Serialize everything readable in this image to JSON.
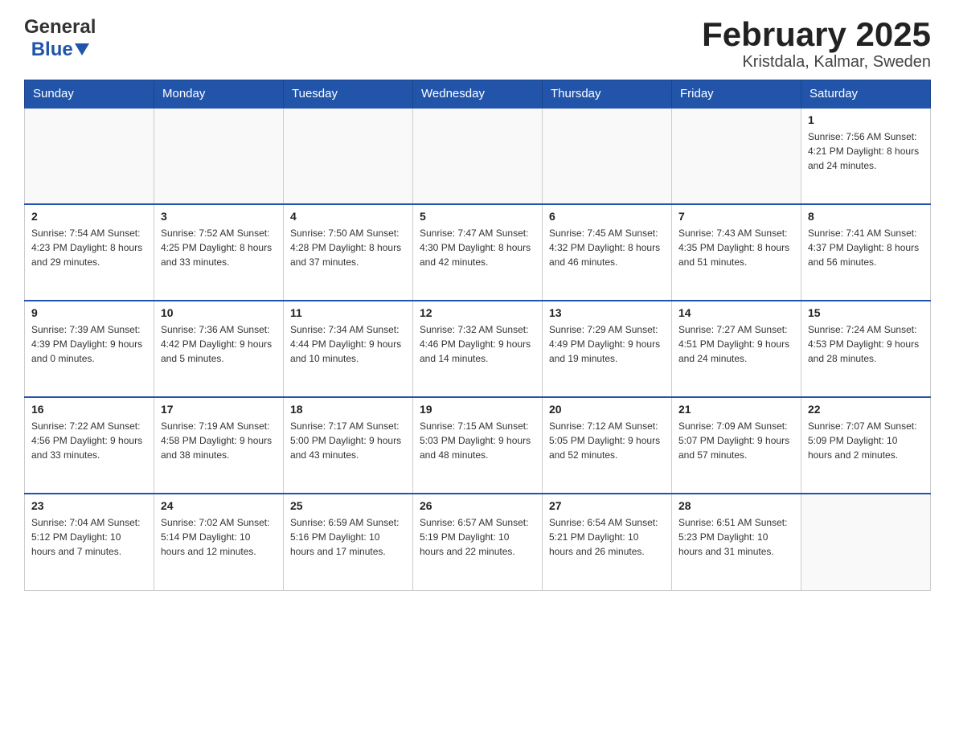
{
  "logo": {
    "general": "General",
    "blue": "Blue"
  },
  "title": "February 2025",
  "subtitle": "Kristdala, Kalmar, Sweden",
  "days_of_week": [
    "Sunday",
    "Monday",
    "Tuesday",
    "Wednesday",
    "Thursday",
    "Friday",
    "Saturday"
  ],
  "weeks": [
    [
      {
        "day": "",
        "info": ""
      },
      {
        "day": "",
        "info": ""
      },
      {
        "day": "",
        "info": ""
      },
      {
        "day": "",
        "info": ""
      },
      {
        "day": "",
        "info": ""
      },
      {
        "day": "",
        "info": ""
      },
      {
        "day": "1",
        "info": "Sunrise: 7:56 AM\nSunset: 4:21 PM\nDaylight: 8 hours and 24 minutes."
      }
    ],
    [
      {
        "day": "2",
        "info": "Sunrise: 7:54 AM\nSunset: 4:23 PM\nDaylight: 8 hours and 29 minutes."
      },
      {
        "day": "3",
        "info": "Sunrise: 7:52 AM\nSunset: 4:25 PM\nDaylight: 8 hours and 33 minutes."
      },
      {
        "day": "4",
        "info": "Sunrise: 7:50 AM\nSunset: 4:28 PM\nDaylight: 8 hours and 37 minutes."
      },
      {
        "day": "5",
        "info": "Sunrise: 7:47 AM\nSunset: 4:30 PM\nDaylight: 8 hours and 42 minutes."
      },
      {
        "day": "6",
        "info": "Sunrise: 7:45 AM\nSunset: 4:32 PM\nDaylight: 8 hours and 46 minutes."
      },
      {
        "day": "7",
        "info": "Sunrise: 7:43 AM\nSunset: 4:35 PM\nDaylight: 8 hours and 51 minutes."
      },
      {
        "day": "8",
        "info": "Sunrise: 7:41 AM\nSunset: 4:37 PM\nDaylight: 8 hours and 56 minutes."
      }
    ],
    [
      {
        "day": "9",
        "info": "Sunrise: 7:39 AM\nSunset: 4:39 PM\nDaylight: 9 hours and 0 minutes."
      },
      {
        "day": "10",
        "info": "Sunrise: 7:36 AM\nSunset: 4:42 PM\nDaylight: 9 hours and 5 minutes."
      },
      {
        "day": "11",
        "info": "Sunrise: 7:34 AM\nSunset: 4:44 PM\nDaylight: 9 hours and 10 minutes."
      },
      {
        "day": "12",
        "info": "Sunrise: 7:32 AM\nSunset: 4:46 PM\nDaylight: 9 hours and 14 minutes."
      },
      {
        "day": "13",
        "info": "Sunrise: 7:29 AM\nSunset: 4:49 PM\nDaylight: 9 hours and 19 minutes."
      },
      {
        "day": "14",
        "info": "Sunrise: 7:27 AM\nSunset: 4:51 PM\nDaylight: 9 hours and 24 minutes."
      },
      {
        "day": "15",
        "info": "Sunrise: 7:24 AM\nSunset: 4:53 PM\nDaylight: 9 hours and 28 minutes."
      }
    ],
    [
      {
        "day": "16",
        "info": "Sunrise: 7:22 AM\nSunset: 4:56 PM\nDaylight: 9 hours and 33 minutes."
      },
      {
        "day": "17",
        "info": "Sunrise: 7:19 AM\nSunset: 4:58 PM\nDaylight: 9 hours and 38 minutes."
      },
      {
        "day": "18",
        "info": "Sunrise: 7:17 AM\nSunset: 5:00 PM\nDaylight: 9 hours and 43 minutes."
      },
      {
        "day": "19",
        "info": "Sunrise: 7:15 AM\nSunset: 5:03 PM\nDaylight: 9 hours and 48 minutes."
      },
      {
        "day": "20",
        "info": "Sunrise: 7:12 AM\nSunset: 5:05 PM\nDaylight: 9 hours and 52 minutes."
      },
      {
        "day": "21",
        "info": "Sunrise: 7:09 AM\nSunset: 5:07 PM\nDaylight: 9 hours and 57 minutes."
      },
      {
        "day": "22",
        "info": "Sunrise: 7:07 AM\nSunset: 5:09 PM\nDaylight: 10 hours and 2 minutes."
      }
    ],
    [
      {
        "day": "23",
        "info": "Sunrise: 7:04 AM\nSunset: 5:12 PM\nDaylight: 10 hours and 7 minutes."
      },
      {
        "day": "24",
        "info": "Sunrise: 7:02 AM\nSunset: 5:14 PM\nDaylight: 10 hours and 12 minutes."
      },
      {
        "day": "25",
        "info": "Sunrise: 6:59 AM\nSunset: 5:16 PM\nDaylight: 10 hours and 17 minutes."
      },
      {
        "day": "26",
        "info": "Sunrise: 6:57 AM\nSunset: 5:19 PM\nDaylight: 10 hours and 22 minutes."
      },
      {
        "day": "27",
        "info": "Sunrise: 6:54 AM\nSunset: 5:21 PM\nDaylight: 10 hours and 26 minutes."
      },
      {
        "day": "28",
        "info": "Sunrise: 6:51 AM\nSunset: 5:23 PM\nDaylight: 10 hours and 31 minutes."
      },
      {
        "day": "",
        "info": ""
      }
    ]
  ]
}
